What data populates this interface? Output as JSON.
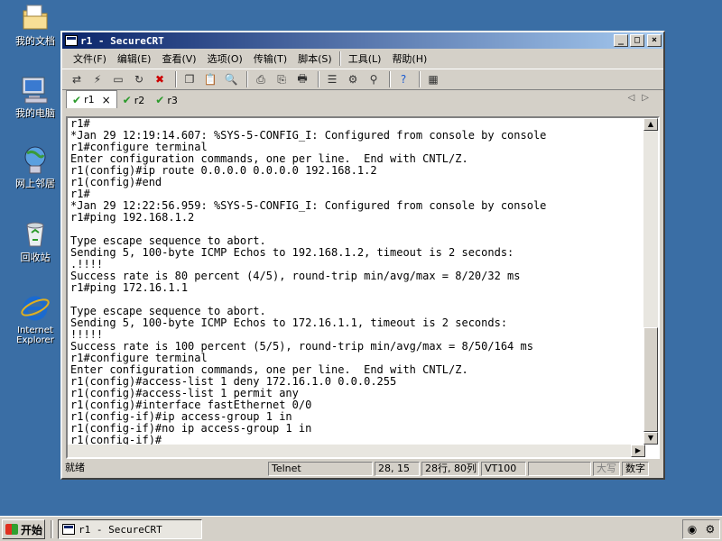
{
  "desktop": {
    "icons": [
      {
        "label": "我的文档"
      },
      {
        "label": "我的电脑"
      },
      {
        "label": "网上邻居"
      },
      {
        "label": "回收站"
      },
      {
        "label": "Internet Explorer"
      }
    ]
  },
  "window": {
    "title": "r1 - SecureCRT",
    "controls": {
      "minimize": "_",
      "maximize": "□",
      "close": "×"
    }
  },
  "menu": [
    "文件(F)",
    "编辑(E)",
    "查看(V)",
    "选项(O)",
    "传输(T)",
    "脚本(S)",
    "工具(L)",
    "帮助(H)"
  ],
  "tabs": [
    {
      "label": "r1",
      "active": true,
      "close": "×"
    },
    {
      "label": "r2"
    },
    {
      "label": "r3"
    }
  ],
  "terminal": {
    "lines": [
      "r1#",
      "*Jan 29 12:19:14.607: %SYS-5-CONFIG_I: Configured from console by console",
      "r1#configure terminal",
      "Enter configuration commands, one per line.  End with CNTL/Z.",
      "r1(config)#ip route 0.0.0.0 0.0.0.0 192.168.1.2",
      "r1(config)#end",
      "r1#",
      "*Jan 29 12:22:56.959: %SYS-5-CONFIG_I: Configured from console by console",
      "r1#ping 192.168.1.2",
      "",
      "Type escape sequence to abort.",
      "Sending 5, 100-byte ICMP Echos to 192.168.1.2, timeout is 2 seconds:",
      ".!!!!",
      "Success rate is 80 percent (4/5), round-trip min/avg/max = 8/20/32 ms",
      "r1#ping 172.16.1.1",
      "",
      "Type escape sequence to abort.",
      "Sending 5, 100-byte ICMP Echos to 172.16.1.1, timeout is 2 seconds:",
      "!!!!!",
      "Success rate is 100 percent (5/5), round-trip min/avg/max = 8/50/164 ms",
      "r1#configure terminal",
      "Enter configuration commands, one per line.  End with CNTL/Z.",
      "r1(config)#access-list 1 deny 172.16.1.0 0.0.0.255",
      "r1(config)#access-list 1 permit any",
      "r1(config)#interface fastEthernet 0/0",
      "r1(config-if)#ip access-group 1 in",
      "r1(config-if)#no ip access-group 1 in",
      "r1(config-if)#"
    ]
  },
  "status": {
    "ready": "就绪",
    "protocol": "Telnet",
    "cursor": "28, 15",
    "size": "28行, 80列",
    "emulation": "VT100",
    "caps": "大写",
    "num": "数字"
  },
  "taskbar": {
    "start": "开始",
    "task": "r1 - SecureCRT"
  }
}
